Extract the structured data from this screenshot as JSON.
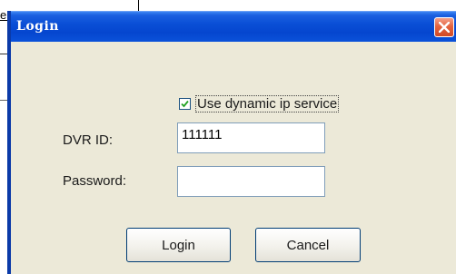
{
  "background": {
    "cell_text": "e"
  },
  "dialog": {
    "title": "Login",
    "close_icon": "close-icon"
  },
  "form": {
    "dynamic_ip_checked": true,
    "dynamic_ip_label": "Use dynamic ip service",
    "dvr_id_label": "DVR ID:",
    "dvr_id_value": "111111",
    "password_label": "Password:",
    "password_value": ""
  },
  "buttons": {
    "login_label": "Login",
    "cancel_label": "Cancel"
  },
  "colors": {
    "titlebar": "#0a4fd6",
    "dialog_bg": "#ece9d8",
    "close_button": "#e4643f"
  }
}
